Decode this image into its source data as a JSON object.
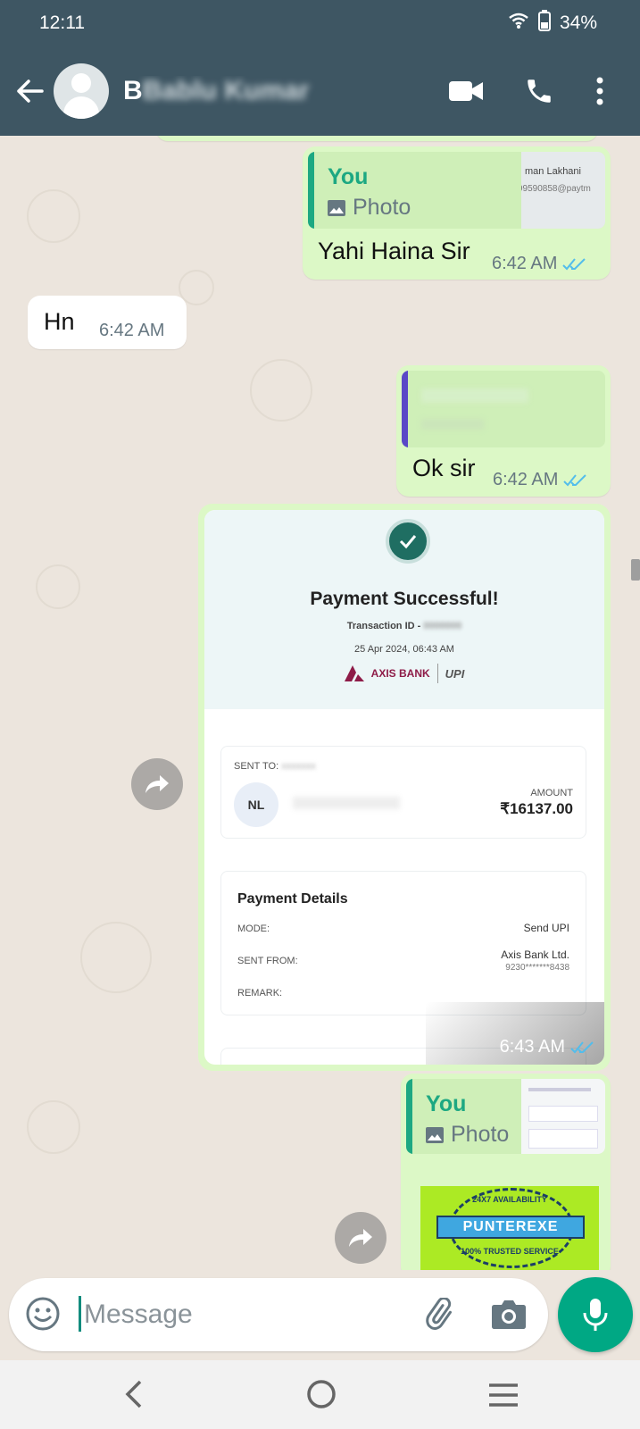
{
  "status_bar": {
    "time": "12:11",
    "battery": "34%"
  },
  "header": {
    "contact_name_visible": "B",
    "contact_name_obscured": "Bablu Kumar"
  },
  "messages": [
    {
      "type": "out-reply",
      "quote_author": "You",
      "quote_type": "Photo",
      "quote_thumb_text_1": "man Lakhani",
      "quote_thumb_text_2": "99590858@paytm",
      "text": "Yahi Haina Sir",
      "time": "6:42 AM"
    },
    {
      "type": "in",
      "text": "Hn",
      "time": "6:42 AM"
    },
    {
      "type": "out-reply",
      "text": "Ok sir",
      "time": "6:42 AM"
    },
    {
      "type": "out-image",
      "time": "6:43 AM"
    },
    {
      "type": "out-reply",
      "quote_author": "You",
      "quote_type": "Photo"
    }
  ],
  "payment": {
    "title": "Payment Successful!",
    "transaction_label": "Transaction ID -",
    "date": "25 Apr 2024, 06:43 AM",
    "bank": "AXIS BANK",
    "upi": "UPI",
    "sent_to_label": "SENT TO:",
    "initials": "NL",
    "amount_label": "AMOUNT",
    "amount": "₹16137.00",
    "details_title": "Payment Details",
    "mode_label": "MODE:",
    "mode_value": "Send UPI",
    "sent_from_label": "SENT FROM:",
    "sent_from_value": "Axis Bank Ltd.",
    "sent_from_account": "9230*******8438",
    "remark_label": "REMARK:"
  },
  "promo": {
    "top": "24X7 AVAILABILITY",
    "band": "PUNTEREXE",
    "bottom": "100% TRUSTED SERVICE"
  },
  "input": {
    "placeholder": "Message"
  },
  "colors": {
    "header": "#3E5663",
    "outgoing": "#DCF8C6",
    "accent": "#00A884",
    "read_ticks": "#53BDEB"
  }
}
